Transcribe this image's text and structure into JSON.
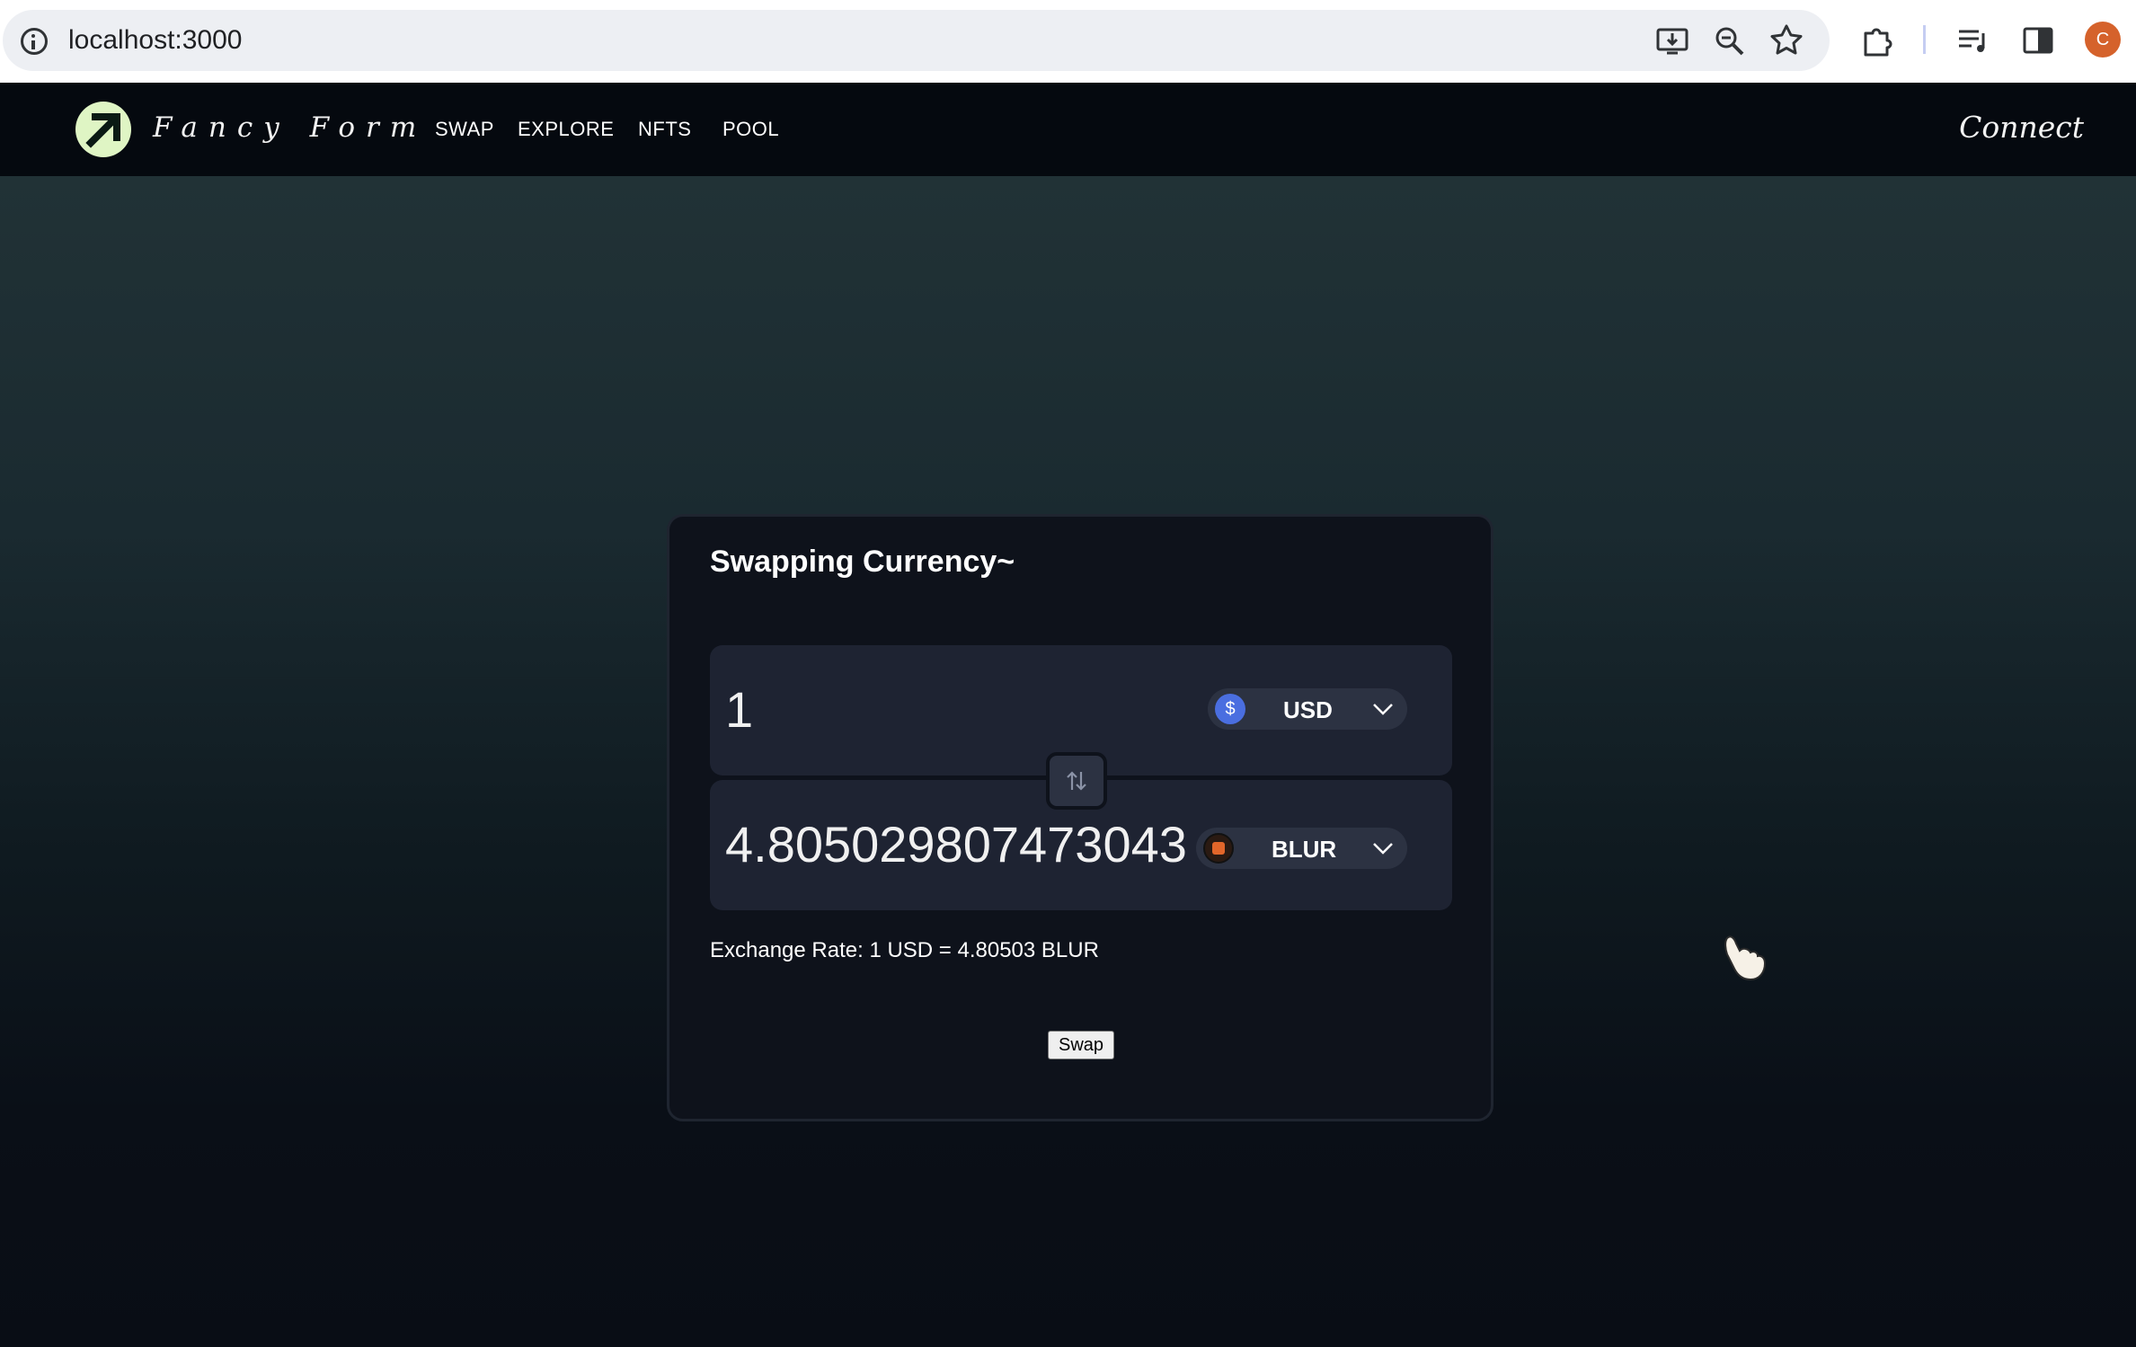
{
  "browser": {
    "url": "localhost:3000",
    "profile_initial": "C",
    "icons": [
      "info-icon",
      "install-app-icon",
      "zoom-icon",
      "bookmark-star-icon",
      "extensions-icon",
      "media-queue-icon",
      "side-panel-icon"
    ]
  },
  "nav": {
    "brand": "Fancy Form",
    "links": [
      "SWAP",
      "EXPLORE",
      "NFTS",
      "POOL"
    ],
    "connect": "Connect"
  },
  "swap_card": {
    "title": "Swapping Currency~",
    "from": {
      "amount": "1",
      "token": "USD",
      "icon": "dollar-icon"
    },
    "to": {
      "amount": "4.805029807473043",
      "token": "BLUR",
      "icon": "blur-token-icon"
    },
    "exchange_rate": "Exchange Rate: 1 USD = 4.80503 BLUR",
    "swap_button": "Swap"
  },
  "colors": {
    "profile": "#d5622b",
    "usd_icon": "#4a6ee0",
    "blur_icon": "#e2662a",
    "logo": "#dff5c4"
  }
}
